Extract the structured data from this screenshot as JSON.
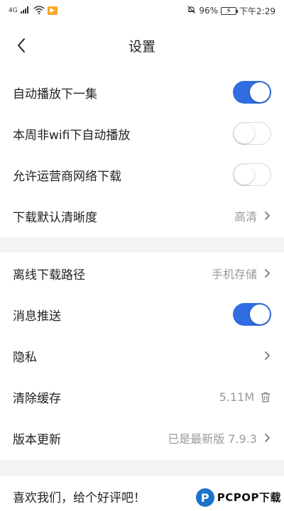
{
  "status_bar": {
    "network": "4G",
    "battery_percent": "96%",
    "time": "下午2:29"
  },
  "header": {
    "title": "设置",
    "back_icon": "chevron-left-icon"
  },
  "group1": [
    {
      "label": "自动播放下一集",
      "type": "toggle",
      "on": true
    },
    {
      "label": "本周非wifi下自动播放",
      "type": "toggle",
      "on": false
    },
    {
      "label": "允许运营商网络下载",
      "type": "toggle",
      "on": false
    },
    {
      "label": "下载默认清晰度",
      "type": "value",
      "value": "高清"
    }
  ],
  "group2": [
    {
      "label": "离线下载路径",
      "type": "value",
      "value": "手机存储"
    },
    {
      "label": "消息推送",
      "type": "toggle",
      "on": true
    },
    {
      "label": "隐私",
      "type": "link"
    },
    {
      "label": "清除缓存",
      "type": "value",
      "value": "5.11M",
      "icon": "trash-icon"
    },
    {
      "label": "版本更新",
      "type": "value",
      "value": "已是最新版 7.9.3"
    }
  ],
  "group3": [
    {
      "label": "喜欢我们，给个好评吧！"
    }
  ],
  "watermark": {
    "brand": "PCPOP下载"
  },
  "colors": {
    "toggle_on": "#2f6de1",
    "section_gap": "#f4f4f4",
    "value_text": "#9a9a9a"
  }
}
